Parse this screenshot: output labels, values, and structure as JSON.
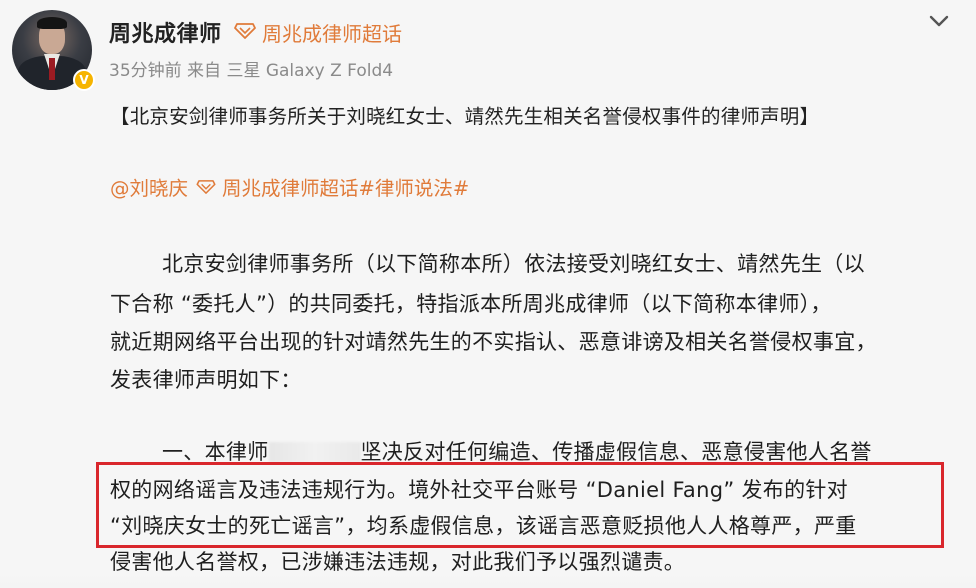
{
  "post": {
    "author_name": "周兆成律师",
    "verified_badge": "V",
    "topic_label": "周兆成律师超话",
    "meta": "35分钟前 来自 三星 Galaxy Z Fold4",
    "title": "【北京安剑律师事务所关于刘晓红女士、靖然先生相关名誉侵权事件的律师声明】",
    "mentions": {
      "user": "@刘晓庆",
      "topics": "周兆成律师超话#律师说法#"
    },
    "body_lines": [
      "北京安剑律师事务所（以下简称本所）依法接受刘晓红女士、靖然先生（以",
      "下合称 “委托人”）的共同委托，特指派本所周兆成律师（以下简称本律师），",
      "就近期网络平台出现的针对靖然先生的不实指认、恶意诽谤及相关名誉侵权事宜，",
      "发表律师声明如下："
    ],
    "clause_1": {
      "start": "一、本律师",
      "rest": "坚决反对任何编造、传播虚假信息、恶意侵害他人名誉",
      "line2": "权的网络谣言及违法违规行为。境外社交平台账号 “Daniel Fang” 发布的针对",
      "line3": "“刘晓庆女士的死亡谣言”，均系虚假信息，该谣言恶意贬损他人人格尊严，严重",
      "line4": "侵害他人名誉权，已涉嫌违法违规，对此我们予以强烈谴责。"
    }
  },
  "icons": {
    "topic": "super-topic-diamond-icon",
    "more": "chevron-down-icon"
  },
  "colors": {
    "accent": "#e07b3a",
    "highlight_box": "#d9262c",
    "verified": "#f6b400"
  }
}
